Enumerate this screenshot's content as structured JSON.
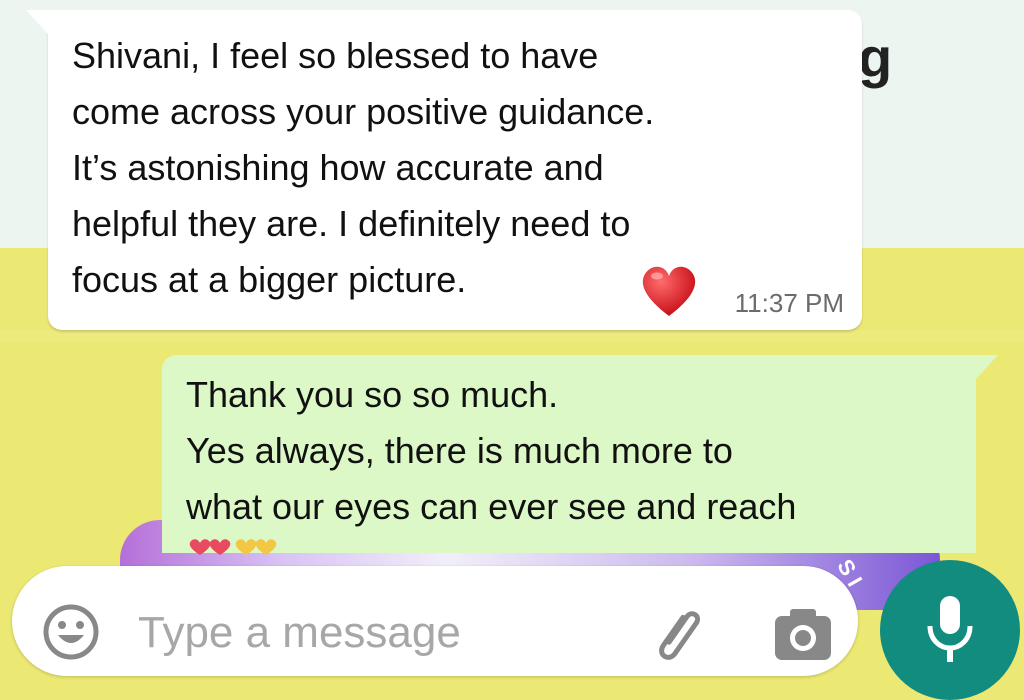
{
  "background": {
    "partial_text": "g"
  },
  "messages": {
    "incoming": {
      "lines": [
        "Shivani, I feel so blessed to have",
        "come across your positive guidance.",
        "It’s astonishing how accurate and",
        "helpful they are. I definitely need to",
        "focus at a bigger picture."
      ],
      "emoji": "red-heart",
      "time": "11:37 PM"
    },
    "outgoing": {
      "lines": [
        "Thank you so so much.",
        "Yes always,  there is much more to",
        "what our eyes can ever see and reach"
      ],
      "emoji": "hearts-cut-off"
    }
  },
  "composer": {
    "placeholder": "Type a message",
    "value": "",
    "icons": [
      "emoji-icon",
      "paperclip-icon",
      "camera-icon",
      "microphone-icon"
    ]
  },
  "colors": {
    "incoming_bubble": "#ffffff",
    "outgoing_bubble": "#dcf8c6",
    "mic_button": "#128c7e",
    "wallpaper_yellow": "#ece874"
  }
}
